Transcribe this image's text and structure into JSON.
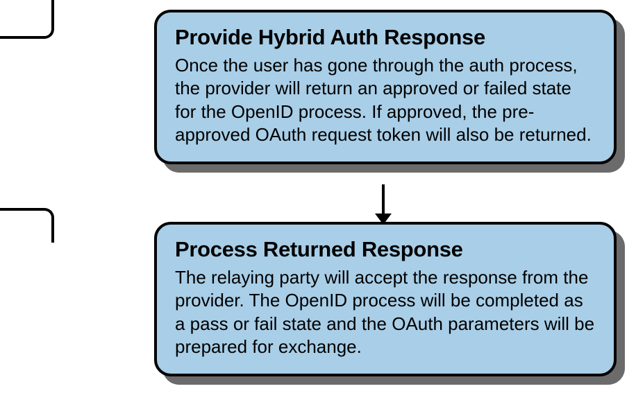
{
  "boxes": [
    {
      "title": "Provide Hybrid Auth Response",
      "body": "Once the user has gone through the auth process, the provider will return an approved or failed state for the OpenID process. If approved, the pre-approved OAuth request token will also be returned."
    },
    {
      "title": "Process Returned Response",
      "body": "The relaying party will accept the response from the provider. The OpenID process will be completed as a pass or fail state and the OAuth parameters will be prepared for exchange."
    }
  ],
  "colors": {
    "card_fill": "#a9cee7",
    "shadow": "#6b6b6b",
    "stroke": "#000000"
  }
}
